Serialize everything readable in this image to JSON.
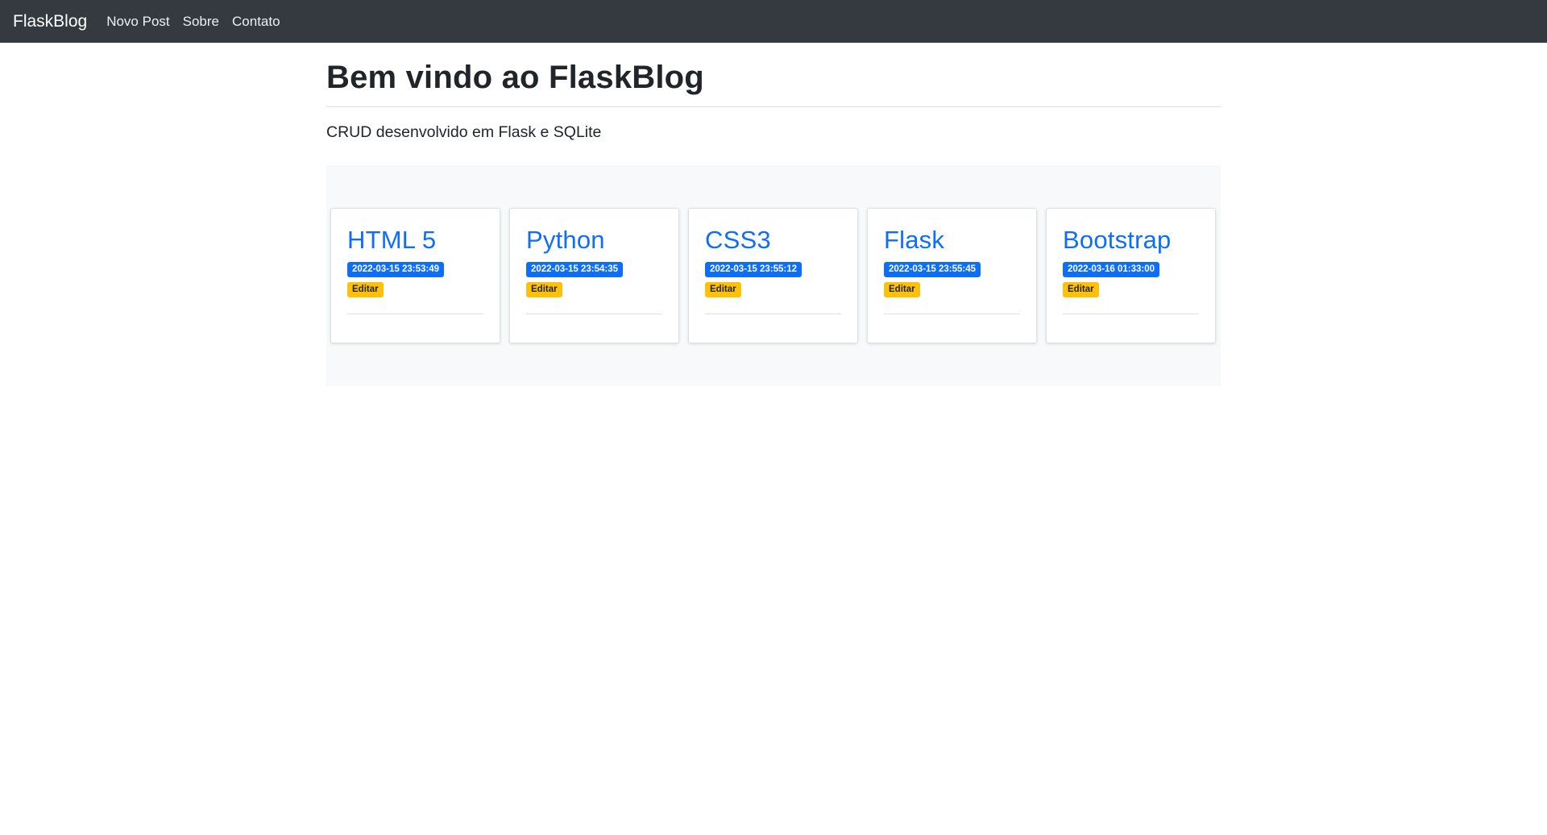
{
  "navbar": {
    "brand": "FlaskBlog",
    "links": [
      {
        "label": "Novo Post"
      },
      {
        "label": "Sobre"
      },
      {
        "label": "Contato"
      }
    ]
  },
  "main": {
    "title": "Bem vindo ao FlaskBlog",
    "subtitle": "CRUD desenvolvido em Flask e SQLite"
  },
  "posts": [
    {
      "title": "HTML 5",
      "date": "2022-03-15 23:53:49",
      "edit_label": "Editar"
    },
    {
      "title": "Python",
      "date": "2022-03-15 23:54:35",
      "edit_label": "Editar"
    },
    {
      "title": "CSS3",
      "date": "2022-03-15 23:55:12",
      "edit_label": "Editar"
    },
    {
      "title": "Flask",
      "date": "2022-03-15 23:55:45",
      "edit_label": "Editar"
    },
    {
      "title": "Bootstrap",
      "date": "2022-03-16 01:33:00",
      "edit_label": "Editar"
    }
  ],
  "colors": {
    "navbar_bg": "#343a40",
    "link_blue": "#0d6efd",
    "badge_warning": "#ffc107",
    "posts_bg": "#f8f9fa"
  }
}
